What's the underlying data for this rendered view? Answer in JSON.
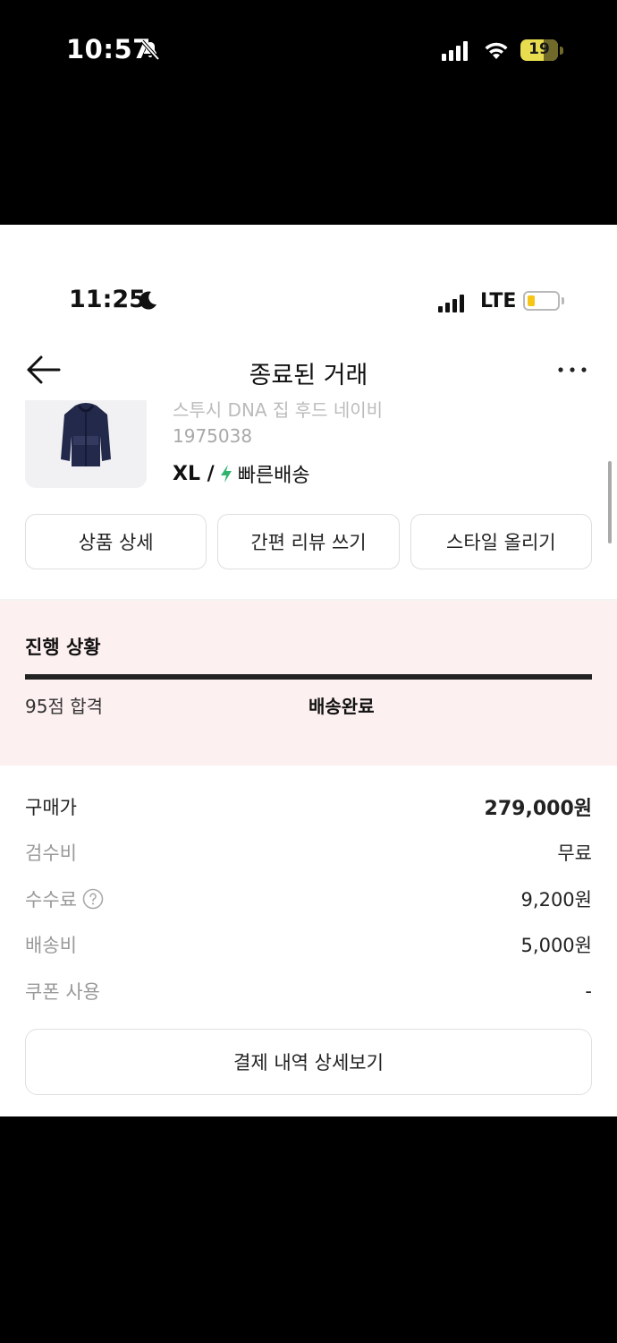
{
  "outer_status": {
    "time": "10:57",
    "battery": "19",
    "battery_color": "#e8dd4e"
  },
  "inner_status": {
    "time": "11:25",
    "network": "LTE",
    "battery_color": "#f5c518"
  },
  "nav": {
    "title": "종료된 거래",
    "back_icon": "arrow-left-icon",
    "more_icon": "more-horizontal-icon"
  },
  "product": {
    "name": "스투시 DNA 집 후드 네이비",
    "code": "1975038",
    "size": "XL /",
    "delivery": "빠른배송",
    "delivery_color": "#31b46e"
  },
  "actions": {
    "detail": "상품 상세",
    "review": "간편 리뷰 쓰기",
    "style": "스타일 올리기"
  },
  "progress": {
    "title": "진행 상황",
    "step1": "95점 합격",
    "step2": "배송완료",
    "background": "#fdf0f0"
  },
  "prices": [
    {
      "label": "구매가",
      "value": "279,000원"
    },
    {
      "label": "검수비",
      "value": "무료"
    },
    {
      "label": "수수료",
      "value": "9,200원"
    },
    {
      "label": "배송비",
      "value": "5,000원"
    },
    {
      "label": "쿠폰 사용",
      "value": "-"
    }
  ],
  "payment_detail_button": "결제 내역 상세보기"
}
